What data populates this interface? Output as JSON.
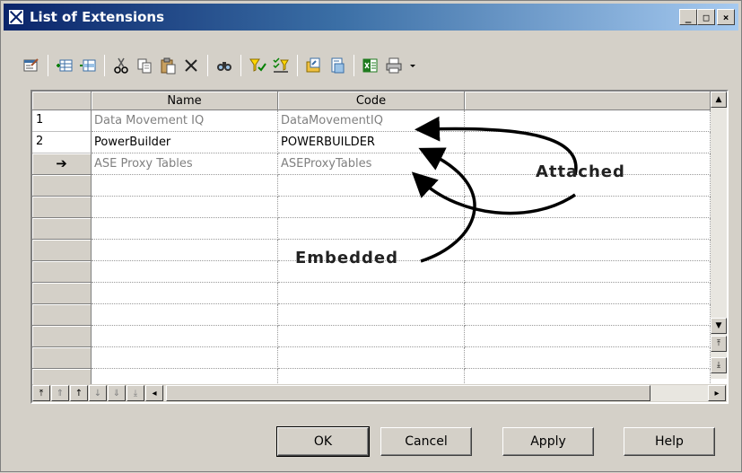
{
  "window": {
    "title": "List of Extensions"
  },
  "titlebar_buttons": {
    "minimize": "_",
    "maximize": "□",
    "close": "×"
  },
  "toolbar": {
    "items": [
      "properties-icon",
      "add-row-icon",
      "insert-row-icon",
      "cut-icon",
      "copy-icon",
      "paste-icon",
      "delete-icon",
      "find-icon",
      "filter-icon",
      "select-all-icon",
      "import-icon",
      "export-icon",
      "excel-icon",
      "print-icon",
      "dropdown-arrow-icon"
    ]
  },
  "grid": {
    "columns": [
      "Name",
      "Code"
    ],
    "rows": [
      {
        "num": "1",
        "name": "Data Movement IQ",
        "code": "DataMovementIQ",
        "style": "grey"
      },
      {
        "num": "2",
        "name": "PowerBuilder",
        "code": "POWERBUILDER",
        "style": "normal"
      },
      {
        "num": "➔",
        "name": "ASE Proxy Tables",
        "code": "ASEProxyTables",
        "style": "grey"
      }
    ]
  },
  "annotations": {
    "attached": "Attached",
    "embedded": "Embedded"
  },
  "buttons": {
    "ok": "OK",
    "cancel": "Cancel",
    "apply": "Apply",
    "help": "Help"
  },
  "colors": {
    "title_start": "#0a246a",
    "title_end": "#a6caf0",
    "face": "#d4d0c8"
  }
}
